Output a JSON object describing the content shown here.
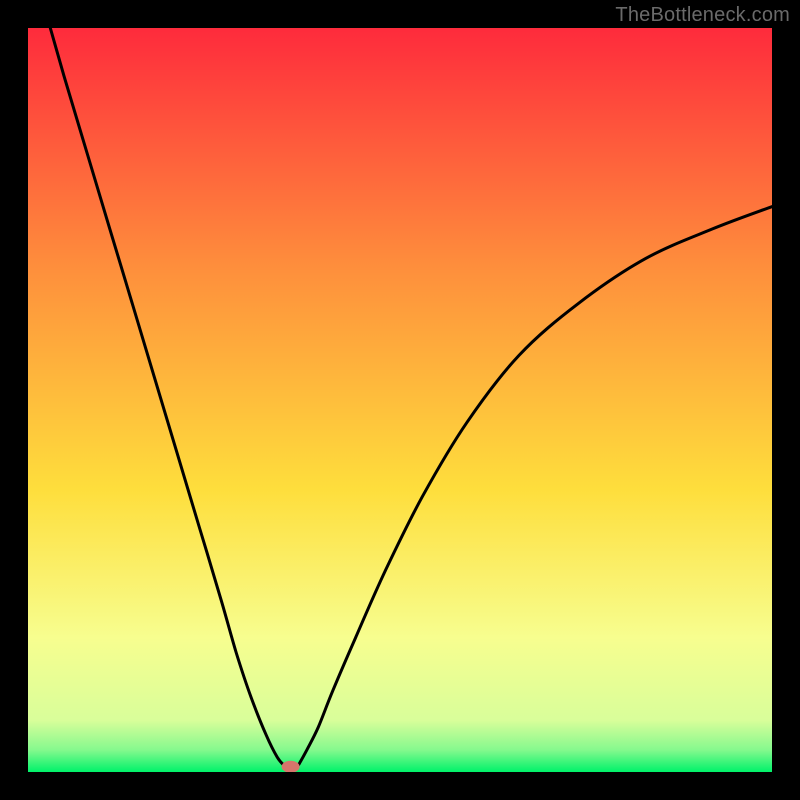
{
  "watermark": {
    "text": "TheBottleneck.com"
  },
  "colors": {
    "gradient_top": "#fe2b3c",
    "gradient_mid1": "#fe8e3c",
    "gradient_mid2": "#fede3c",
    "gradient_mid3": "#f7fe8f",
    "gradient_bottom": "#00f26a",
    "background": "#000000",
    "curve": "#000000",
    "marker": "#d6756b"
  },
  "chart_data": {
    "type": "line",
    "title": "",
    "xlabel": "",
    "ylabel": "",
    "xlim": [
      0,
      100
    ],
    "ylim": [
      0,
      100
    ],
    "x": [
      3,
      5,
      8,
      11,
      14,
      17,
      20,
      23,
      26,
      28,
      30,
      32,
      33.5,
      34.5,
      35,
      35.5,
      36,
      36.5,
      37.5,
      39,
      41,
      44,
      48,
      53,
      59,
      66,
      74,
      83,
      92,
      100
    ],
    "values": [
      100,
      93,
      83,
      73,
      63,
      53,
      43,
      33,
      23,
      16,
      10,
      5,
      2,
      0.8,
      0.4,
      0.3,
      0.5,
      1.2,
      3,
      6,
      11,
      18,
      27,
      37,
      47,
      56,
      63,
      69,
      73,
      76
    ],
    "minimum": {
      "x": 35.3,
      "y": 0.3
    }
  }
}
